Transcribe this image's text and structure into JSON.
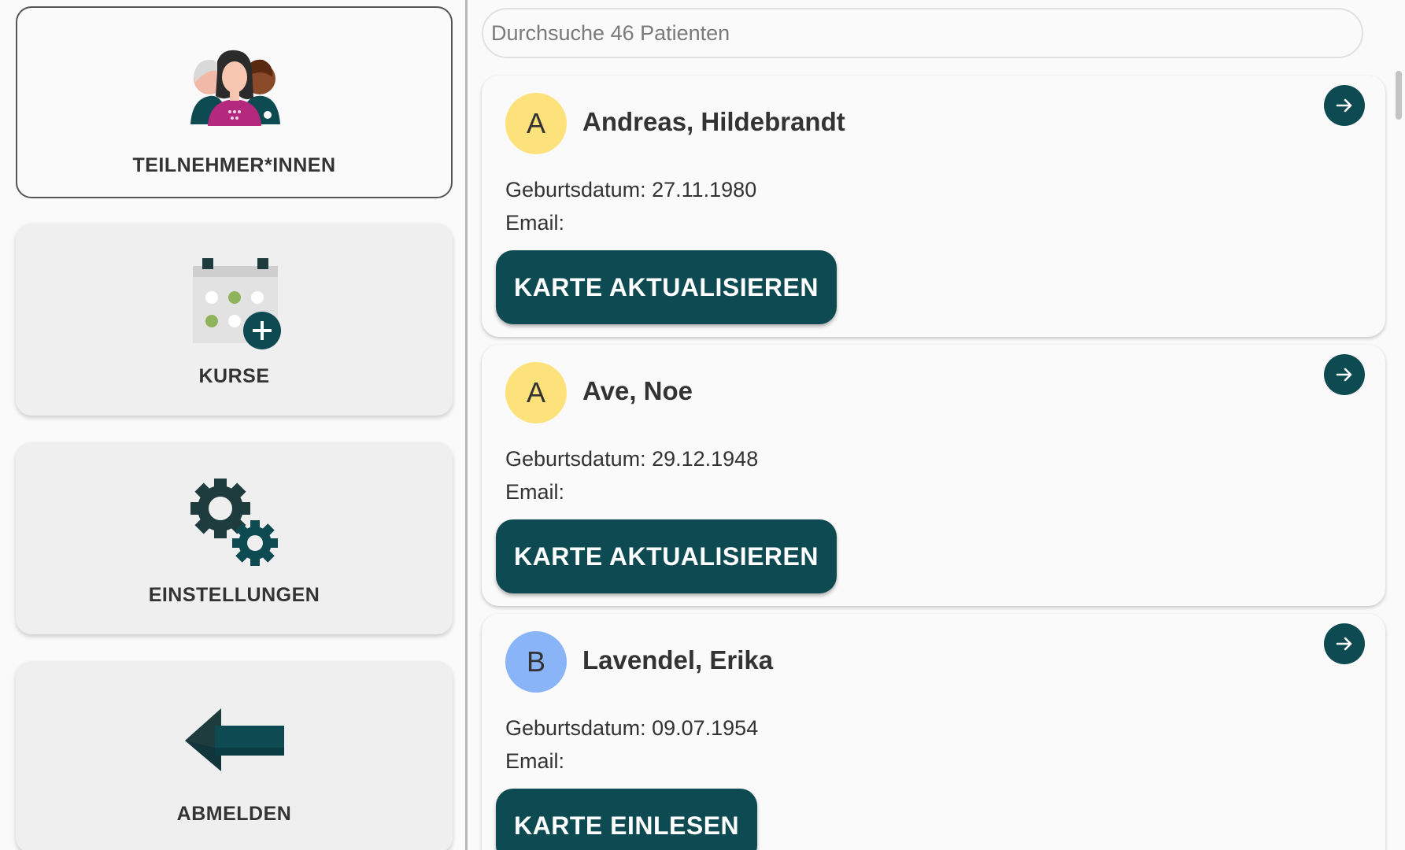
{
  "sidebar": {
    "items": [
      {
        "label": "TEILNEHMER*INNEN",
        "icon": "participants-icon",
        "active": true
      },
      {
        "label": "KURSE",
        "icon": "calendar-add-icon",
        "active": false
      },
      {
        "label": "EINSTELLUNGEN",
        "icon": "gears-icon",
        "active": false
      },
      {
        "label": "ABMELDEN",
        "icon": "back-arrow-icon",
        "active": false
      }
    ]
  },
  "search": {
    "placeholder": "Durchsuche 46 Patienten"
  },
  "patients": [
    {
      "initial": "A",
      "name": "Andreas, Hildebrandt",
      "birth_line": "Geburtsdatum: 27.11.1980",
      "email_line": "Email:",
      "action": "KARTE AKTUALISIEREN",
      "avatar_color": "#fde17a"
    },
    {
      "initial": "A",
      "name": "Ave, Noe",
      "birth_line": "Geburtsdatum: 29.12.1948",
      "email_line": "Email:",
      "action": "KARTE AKTUALISIEREN",
      "avatar_color": "#fde17a"
    },
    {
      "initial": "B",
      "name": "Lavendel, Erika",
      "birth_line": "Geburtsdatum: 09.07.1954",
      "email_line": "Email:",
      "action": "KARTE EINLESEN",
      "avatar_color": "#8ab4f8"
    }
  ],
  "colors": {
    "primary": "#0d4a52",
    "avatar_yellow": "#fde17a",
    "avatar_blue": "#8ab4f8"
  }
}
